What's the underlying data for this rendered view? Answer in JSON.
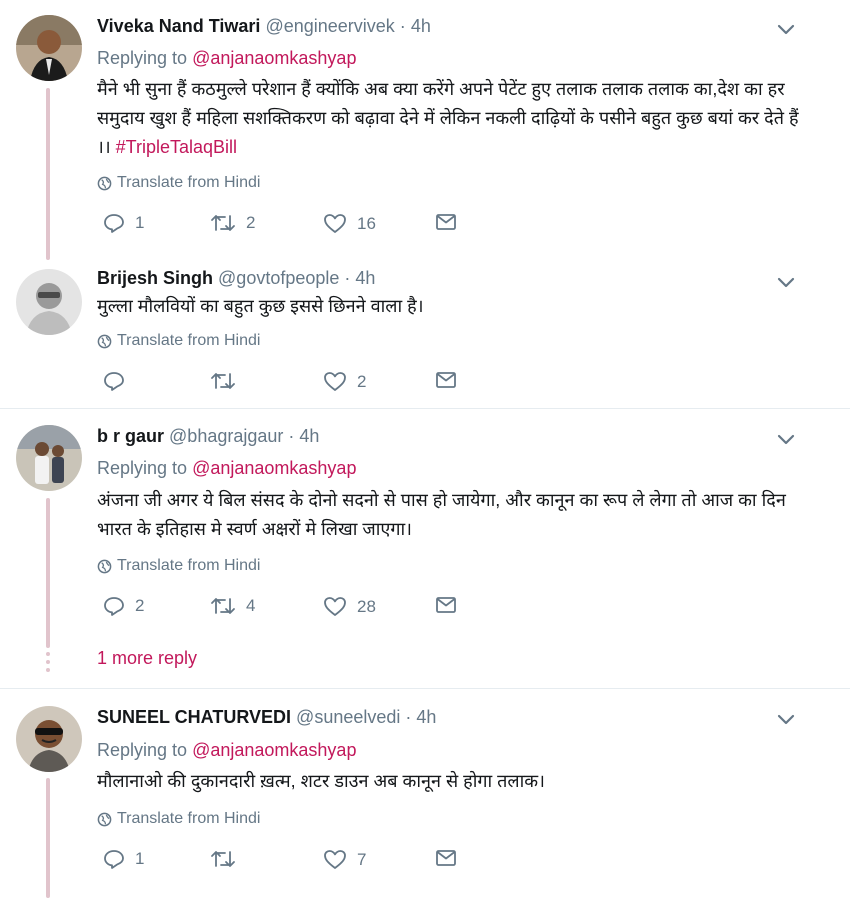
{
  "tweets": [
    {
      "name": "Viveka Nand Tiwari",
      "handle": "@engineervivek",
      "time": "4h",
      "replying_prefix": "Replying to",
      "replying_to": "@anjanaomkashyap",
      "text": "मैने भी सुना हैं कठमुल्ले परेशान हैं क्योंकि अब क्या करेंगे अपने पेटेंट हुए तलाक तलाक तलाक का,देश का हर समुदाय खुश हैं महिला सशक्तिकरण को बढ़ावा देने में लेकिन नकली दाढ़ियों के पसीने बहुत कुछ बयां कर देते हैं ।। ",
      "hashtag": "#TripleTalaqBill",
      "translate": "Translate from Hindi",
      "replies": "1",
      "retweets": "2",
      "likes": "16"
    },
    {
      "name": "Brijesh Singh",
      "handle": "@govtofpeople",
      "time": "4h",
      "text": "मुल्ला मौलवियों का बहुत कुछ इससे छिनने वाला है।",
      "translate": "Translate from Hindi",
      "replies": "",
      "retweets": "",
      "likes": "2"
    },
    {
      "name": "b r gaur",
      "handle": "@bhagrajgaur",
      "time": "4h",
      "replying_prefix": "Replying to",
      "replying_to": "@anjanaomkashyap",
      "text": "अंजना जी अगर  ये बिल संसद के दोनो सदनो से पास हो जायेगा, और कानून का रूप ले लेगा तो आज का दिन भारत के इतिहास मे स्वर्ण अक्षरों मे लिखा जाएगा।",
      "translate": "Translate from Hindi",
      "replies": "2",
      "retweets": "4",
      "likes": "28"
    },
    {
      "name": "SUNEEL CHATURVEDI",
      "handle": "@suneelvedi",
      "time": "4h",
      "replying_prefix": "Replying to",
      "replying_to": "@anjanaomkashyap",
      "text": "मौलानाओ की दुकानदारी ख़त्म, शटर डाउन अब कानून से होगा तलाक।",
      "translate": "Translate from Hindi",
      "replies": "1",
      "retweets": "",
      "likes": "7"
    }
  ],
  "more_reply": "1 more reply",
  "colors": {
    "accent": "#c2185b",
    "muted": "#657786",
    "thread_line": "#e1c4cc",
    "separator": "#e6ecf0"
  },
  "icons": [
    "reply-icon",
    "retweet-icon",
    "like-icon",
    "message-icon",
    "globe-icon",
    "chevron-down-icon"
  ]
}
